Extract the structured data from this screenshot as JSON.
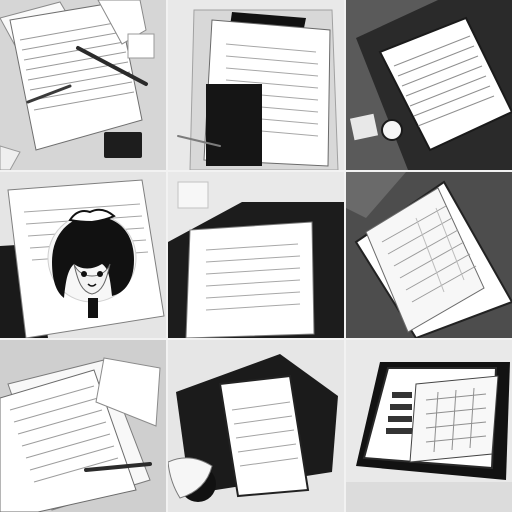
{
  "scene": {
    "background": "#f2f2f2",
    "tile_count": 9
  },
  "tiles": [
    {
      "name": "tile-1",
      "bg": "#d6d6d6"
    },
    {
      "name": "tile-2",
      "bg": "#e9e9e9"
    },
    {
      "name": "tile-3",
      "bg": "#5a5a5a"
    },
    {
      "name": "tile-4",
      "bg": "#e5e5e5"
    },
    {
      "name": "tile-5",
      "bg": "#e9e9e9"
    },
    {
      "name": "tile-6",
      "bg": "#4d4d4d"
    },
    {
      "name": "tile-7",
      "bg": "#cfcfcf"
    },
    {
      "name": "tile-8",
      "bg": "#e6e6e6"
    },
    {
      "name": "tile-9",
      "bg": "#e9e9e9"
    }
  ]
}
